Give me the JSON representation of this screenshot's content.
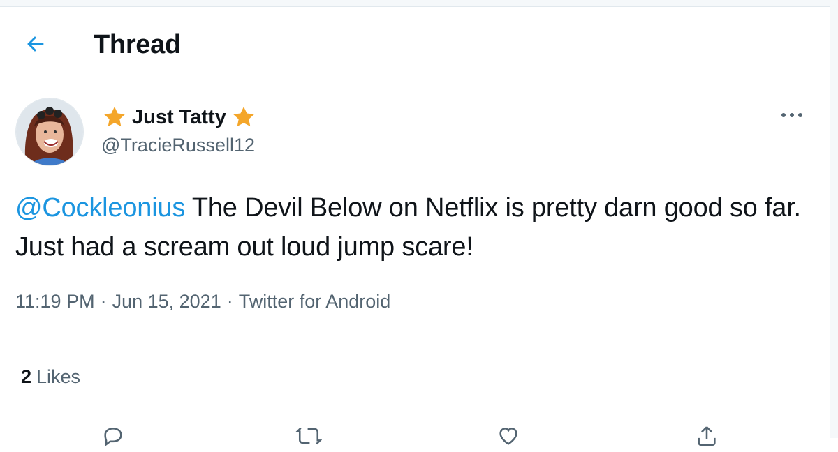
{
  "header": {
    "back_icon": "arrow-left-icon",
    "title": "Thread"
  },
  "tweet": {
    "author": {
      "display_name": "Just Tatty",
      "name_decoration": "star-icon",
      "handle": "@TracieRussell12"
    },
    "mention": "@Cockleonius",
    "text": " The Devil Below on Netflix is pretty darn good so far. Just had a scream out loud jump scare!",
    "time": "11:19 PM",
    "date": "Jun 15, 2021",
    "source": "Twitter for Android",
    "separator": "·",
    "likes_count": "2",
    "likes_label": "Likes"
  },
  "actions": [
    "reply-icon",
    "retweet-icon",
    "like-icon",
    "share-icon"
  ],
  "colors": {
    "accent": "#1b95e0",
    "star": "#f4a62a",
    "secondary_text": "#536471",
    "divider": "#e6ecf0"
  }
}
